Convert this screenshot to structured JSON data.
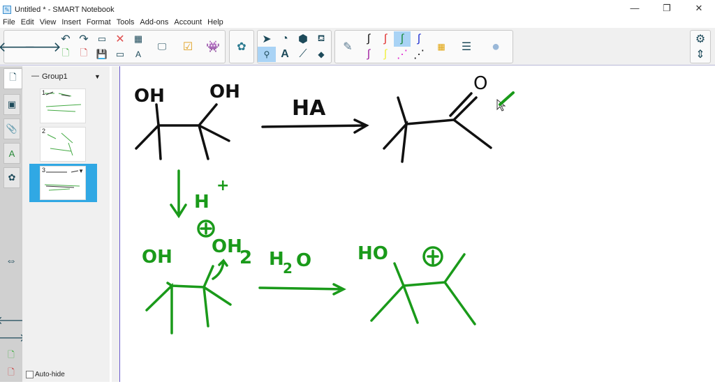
{
  "window": {
    "title": "Untitled * - SMART Notebook",
    "controls": [
      "—",
      "❐",
      "✕"
    ]
  },
  "menu": [
    "File",
    "Edit",
    "View",
    "Insert",
    "Format",
    "Tools",
    "Add-ons",
    "Account",
    "Help"
  ],
  "sidebar": {
    "group_label": "Group1",
    "collapse": "—",
    "dropdown": "▼",
    "auto_hide_label": "Auto-hide",
    "page_numbers": [
      "1",
      "2",
      "3"
    ]
  },
  "canvas": {
    "black": {
      "oh_left": "OH",
      "oh_right": "OH",
      "reagent": "HA",
      "carbonyl_o": "O"
    },
    "green": {
      "h_plus": "H",
      "plus": "+",
      "charge": "+",
      "oh": "OH",
      "oh2": "OH",
      "oh2_sub": "2",
      "water_h": "H",
      "water_sub": "2",
      "water_o": "O",
      "ho": "HO",
      "charge2": "+"
    }
  },
  "colors": {
    "ink_black": "#111111",
    "ink_green": "#1a9a1a",
    "selected": "#30a8e4"
  }
}
